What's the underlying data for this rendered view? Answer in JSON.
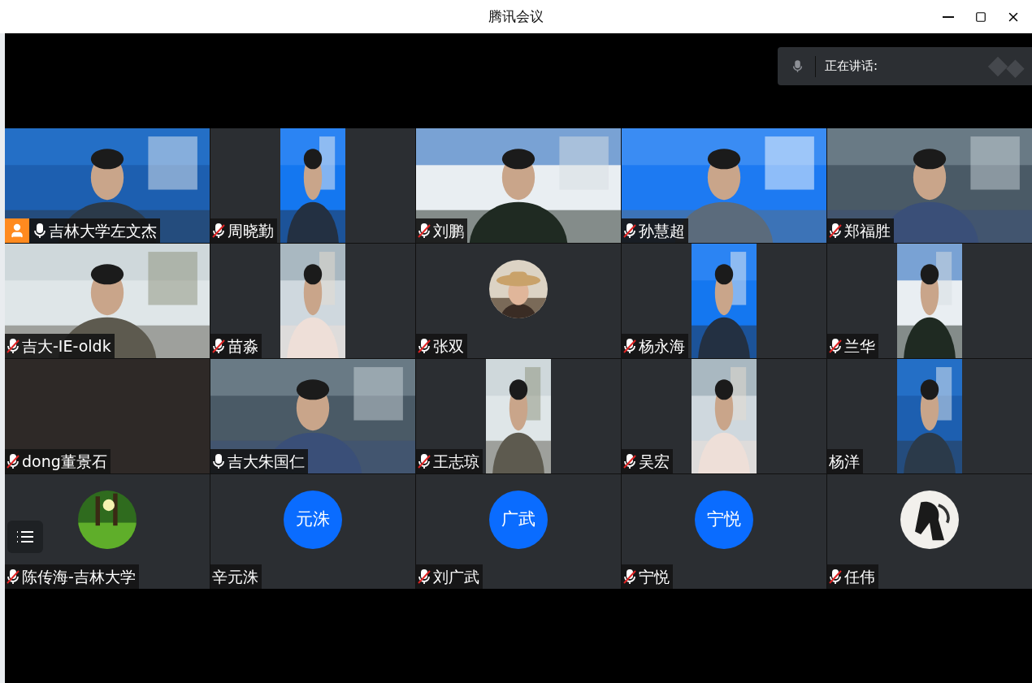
{
  "window": {
    "title": "腾讯会议"
  },
  "speaking": {
    "label": "正在讲话:"
  },
  "tiles": [
    {
      "name": "吉林大学左文杰",
      "kind": "video",
      "muted": false,
      "host": true
    },
    {
      "name": "周晓勤",
      "kind": "narrow-video",
      "muted": true,
      "host": false
    },
    {
      "name": "刘鹏",
      "kind": "video",
      "muted": true,
      "host": false
    },
    {
      "name": "孙慧超",
      "kind": "video",
      "muted": true,
      "host": false
    },
    {
      "name": "郑福胜",
      "kind": "video",
      "muted": true,
      "host": false
    },
    {
      "name": "吉大-IE-oldk",
      "kind": "video",
      "muted": true,
      "host": false
    },
    {
      "name": "苗淼",
      "kind": "narrow-video",
      "muted": true,
      "host": false
    },
    {
      "name": "张双",
      "kind": "photo-avatar",
      "muted": true,
      "host": false
    },
    {
      "name": "杨永海",
      "kind": "narrow-video",
      "muted": true,
      "host": false
    },
    {
      "name": "兰华",
      "kind": "narrow-video",
      "muted": true,
      "host": false
    },
    {
      "name": "dong董景石",
      "kind": "blank",
      "muted": true,
      "host": false
    },
    {
      "name": "吉大朱国仁",
      "kind": "video",
      "muted": false,
      "host": false
    },
    {
      "name": "王志琼",
      "kind": "narrow-video",
      "muted": true,
      "host": false
    },
    {
      "name": "吴宏",
      "kind": "narrow-video",
      "muted": true,
      "host": false
    },
    {
      "name": "杨洋",
      "kind": "narrow-video",
      "host": false
    },
    {
      "name": "陈传海-吉林大学",
      "kind": "photo-avatar",
      "muted": true,
      "host": false
    },
    {
      "name": "辛元洙",
      "kind": "initials-avatar",
      "initials": "元洙",
      "host": false
    },
    {
      "name": "刘广武",
      "kind": "initials-avatar",
      "initials": "广武",
      "muted": true,
      "host": false
    },
    {
      "name": "宁悦",
      "kind": "initials-avatar",
      "initials": "宁悦",
      "muted": true,
      "host": false
    },
    {
      "name": "任伟",
      "kind": "photo-avatar",
      "muted": true,
      "host": false
    }
  ]
}
